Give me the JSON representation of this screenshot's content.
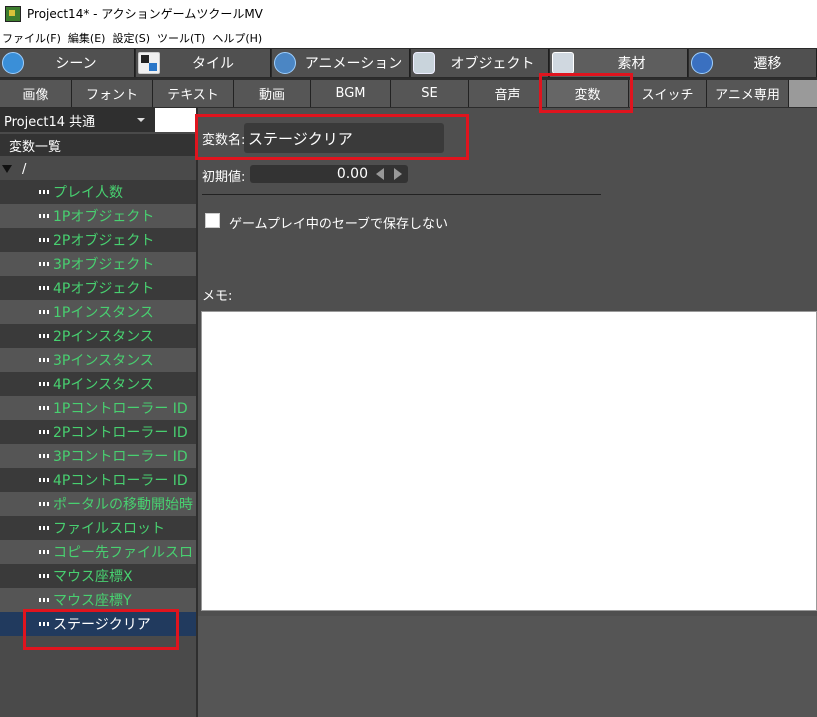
{
  "window": {
    "title": "Project14* - アクションゲームツクールMV"
  },
  "menu": [
    "ファイル(F)",
    "編集(E)",
    "設定(S)",
    "ツール(T)",
    "ヘルプ(H)"
  ],
  "category_tabs": [
    {
      "label": "シーン",
      "icon": "scene-icon"
    },
    {
      "label": "タイル",
      "icon": "tile-icon"
    },
    {
      "label": "アニメーション",
      "icon": "animation-icon"
    },
    {
      "label": "オブジェクト",
      "icon": "object-icon"
    },
    {
      "label": "素材",
      "icon": "layers-icon"
    },
    {
      "label": "遷移",
      "icon": "transition-icon"
    }
  ],
  "sub_tabs": [
    "画像",
    "フォント",
    "テキスト",
    "動画",
    "BGM",
    "SE",
    "音声",
    "変数",
    "スイッチ",
    "アニメ専用"
  ],
  "active_sub_tab": "変数",
  "sidebar": {
    "project_select": "Project14 共通",
    "list_header": "変数一覧",
    "root": "/",
    "variables": [
      "プレイ人数",
      "1Pオブジェクト",
      "2Pオブジェクト",
      "3Pオブジェクト",
      "4Pオブジェクト",
      "1Pインスタンス",
      "2Pインスタンス",
      "3Pインスタンス",
      "4Pインスタンス",
      "1Pコントローラー ID",
      "2Pコントローラー ID",
      "3Pコントローラー ID",
      "4Pコントローラー ID",
      "ポータルの移動開始時",
      "ファイルスロット",
      "コピー先ファイルスロ",
      "マウス座標X",
      "マウス座標Y",
      "ステージクリア"
    ],
    "selected": "ステージクリア"
  },
  "form": {
    "name_label": "変数名:",
    "name_value": "ステージクリア",
    "initial_label": "初期値:",
    "initial_value": "0.00",
    "no_save_label": "ゲームプレイ中のセーブで保存しない",
    "memo_label": "メモ:",
    "memo_value": ""
  },
  "colors": {
    "variable_text": "#48d070",
    "highlight": "#e0141e",
    "selected_row": "#213a5e"
  }
}
